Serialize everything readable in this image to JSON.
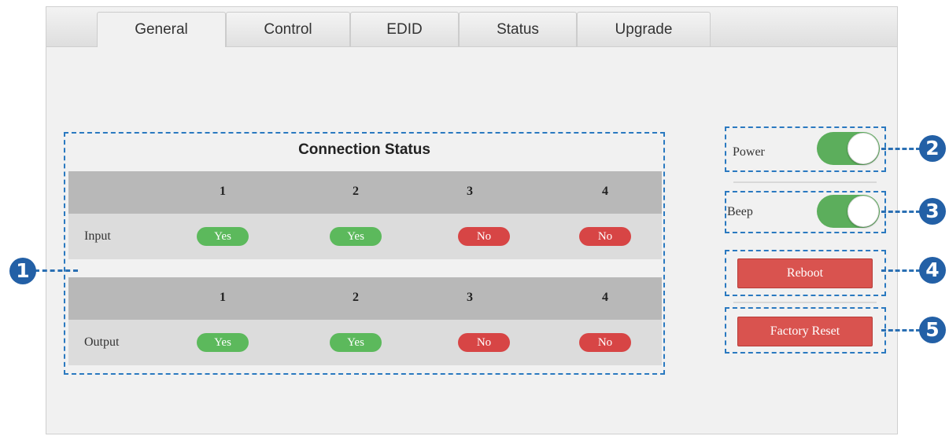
{
  "tabs": [
    {
      "label": "General",
      "active": true
    },
    {
      "label": "Control",
      "active": false
    },
    {
      "label": "EDID",
      "active": false
    },
    {
      "label": "Status",
      "active": false
    },
    {
      "label": "Upgrade",
      "active": false
    }
  ],
  "connection": {
    "title": "Connection Status",
    "columns": [
      "1",
      "2",
      "3",
      "4"
    ],
    "input": {
      "label": "Input",
      "values": [
        "Yes",
        "Yes",
        "No",
        "No"
      ]
    },
    "output": {
      "label": "Output",
      "values": [
        "Yes",
        "Yes",
        "No",
        "No"
      ]
    }
  },
  "controls": {
    "power": {
      "label": "Power",
      "on": true
    },
    "beep": {
      "label": "Beep",
      "on": true
    },
    "reboot_label": "Reboot",
    "factory_reset_label": "Factory Reset"
  },
  "callouts": [
    "1",
    "2",
    "3",
    "4",
    "5"
  ],
  "colors": {
    "yes": "#5cb95c",
    "no": "#d74545",
    "toggle_on": "#5cae5c",
    "button_red": "#d9534f",
    "callout_blue": "#2360a6"
  }
}
